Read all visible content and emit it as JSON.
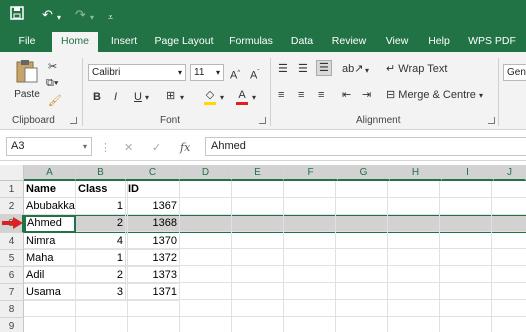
{
  "titlebar": {
    "save_icon": "save-icon",
    "undo_icon": "undo-icon",
    "redo_icon": "redo-icon",
    "customize_icon": "customize-qat-icon"
  },
  "tabs": [
    {
      "label": "File"
    },
    {
      "label": "Home"
    },
    {
      "label": "Insert"
    },
    {
      "label": "Page Layout"
    },
    {
      "label": "Formulas"
    },
    {
      "label": "Data"
    },
    {
      "label": "Review"
    },
    {
      "label": "View"
    },
    {
      "label": "Help"
    },
    {
      "label": "WPS PDF"
    }
  ],
  "ribbon": {
    "clipboard": {
      "paste_label": "Paste",
      "group_label": "Clipboard"
    },
    "font": {
      "font_name": "Calibri",
      "font_size": "11",
      "bold": "B",
      "italic": "I",
      "underline": "U",
      "group_label": "Font"
    },
    "alignment": {
      "wrap_text": "Wrap Text",
      "merge_center": "Merge & Centre",
      "group_label": "Alignment"
    },
    "number": {
      "format": "Gene"
    }
  },
  "formula_bar": {
    "name_box": "A3",
    "fx_label": "fx",
    "content": "Ahmed"
  },
  "columns": [
    "A",
    "B",
    "C",
    "D",
    "E",
    "F",
    "G",
    "H",
    "I",
    "J"
  ],
  "rows": [
    "1",
    "2",
    "3",
    "4",
    "5",
    "6",
    "7",
    "8",
    "9"
  ],
  "sheet": {
    "header": [
      "Name",
      "Class",
      "ID"
    ],
    "data": [
      [
        "Abubakka",
        "1",
        "1367"
      ],
      [
        "Ahmed",
        "2",
        "1368"
      ],
      [
        "Nimra",
        "4",
        "1370"
      ],
      [
        "Maha",
        "1",
        "1372"
      ],
      [
        "Adil",
        "2",
        "1373"
      ],
      [
        "Usama",
        "3",
        "1371"
      ]
    ]
  },
  "colors": {
    "accent": "#217346",
    "arrow": "#e02020"
  }
}
